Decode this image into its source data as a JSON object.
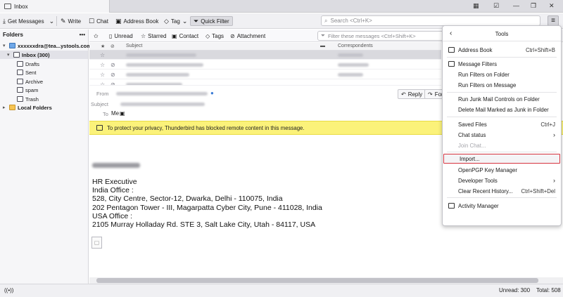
{
  "tab": {
    "label": "Inbox"
  },
  "toolbar": {
    "get_messages": "Get Messages",
    "write": "Write",
    "chat": "Chat",
    "address_book": "Address Book",
    "tag": "Tag",
    "quick_filter": "Quick Filter",
    "search_placeholder": "Search <Ctrl+K>"
  },
  "folders": {
    "header": "Folders",
    "more": "•••",
    "account": "xxxxxxdra@tea...ystools.com",
    "inbox": "Inbox (300)",
    "items": [
      "Drafts",
      "Sent",
      "Archive",
      "spam",
      "Trash"
    ],
    "local": "Local Folders"
  },
  "quickfilter": {
    "unread": "Unread",
    "starred": "Starred",
    "contact": "Contact",
    "tags": "Tags",
    "attachment": "Attachment",
    "filter_placeholder": "Filter these messages <Ctrl+Shift+K>"
  },
  "list": {
    "subject_col": "Subject",
    "correspondents_col": "Correspondents"
  },
  "message": {
    "from_label": "From",
    "subject_label": "Subject",
    "to_label": "To",
    "to_value": "Me",
    "reply": "Reply",
    "forward": "Forw"
  },
  "privacy_notice": "To protect your privacy, Thunderbird has blocked remote content in this message.",
  "body_lines": [
    "HR Executive",
    "India Office :",
    "528, City Centre, Sector-12, Dwarka, Delhi - 110075, India",
    "202 Pentagon Tower - III, Magarpatta Cyber City, Pune - 411028, India",
    "USA Office :",
    "2105 Murray Holladay Rd. STE 3, Salt Lake City, Utah - 84117, USA"
  ],
  "status": {
    "unread": "Unread: 300",
    "total": "Total: 508"
  },
  "tools_menu": {
    "title": "Tools",
    "address_book": {
      "label": "Address Book",
      "shortcut": "Ctrl+Shift+B"
    },
    "message_filters": "Message Filters",
    "run_filters_folder": "Run Filters on Folder",
    "run_filters_message": "Run Filters on Message",
    "run_junk": "Run Junk Mail Controls on Folder",
    "delete_junk": "Delete Mail Marked as Junk in Folder",
    "saved_files": {
      "label": "Saved Files",
      "shortcut": "Ctrl+J"
    },
    "chat_status": "Chat status",
    "join_chat": "Join Chat...",
    "import": "Import...",
    "openpgp": "OpenPGP Key Manager",
    "developer_tools": "Developer Tools",
    "clear_history": {
      "label": "Clear Recent History...",
      "shortcut": "Ctrl+Shift+Del"
    },
    "activity_manager": "Activity Manager"
  }
}
